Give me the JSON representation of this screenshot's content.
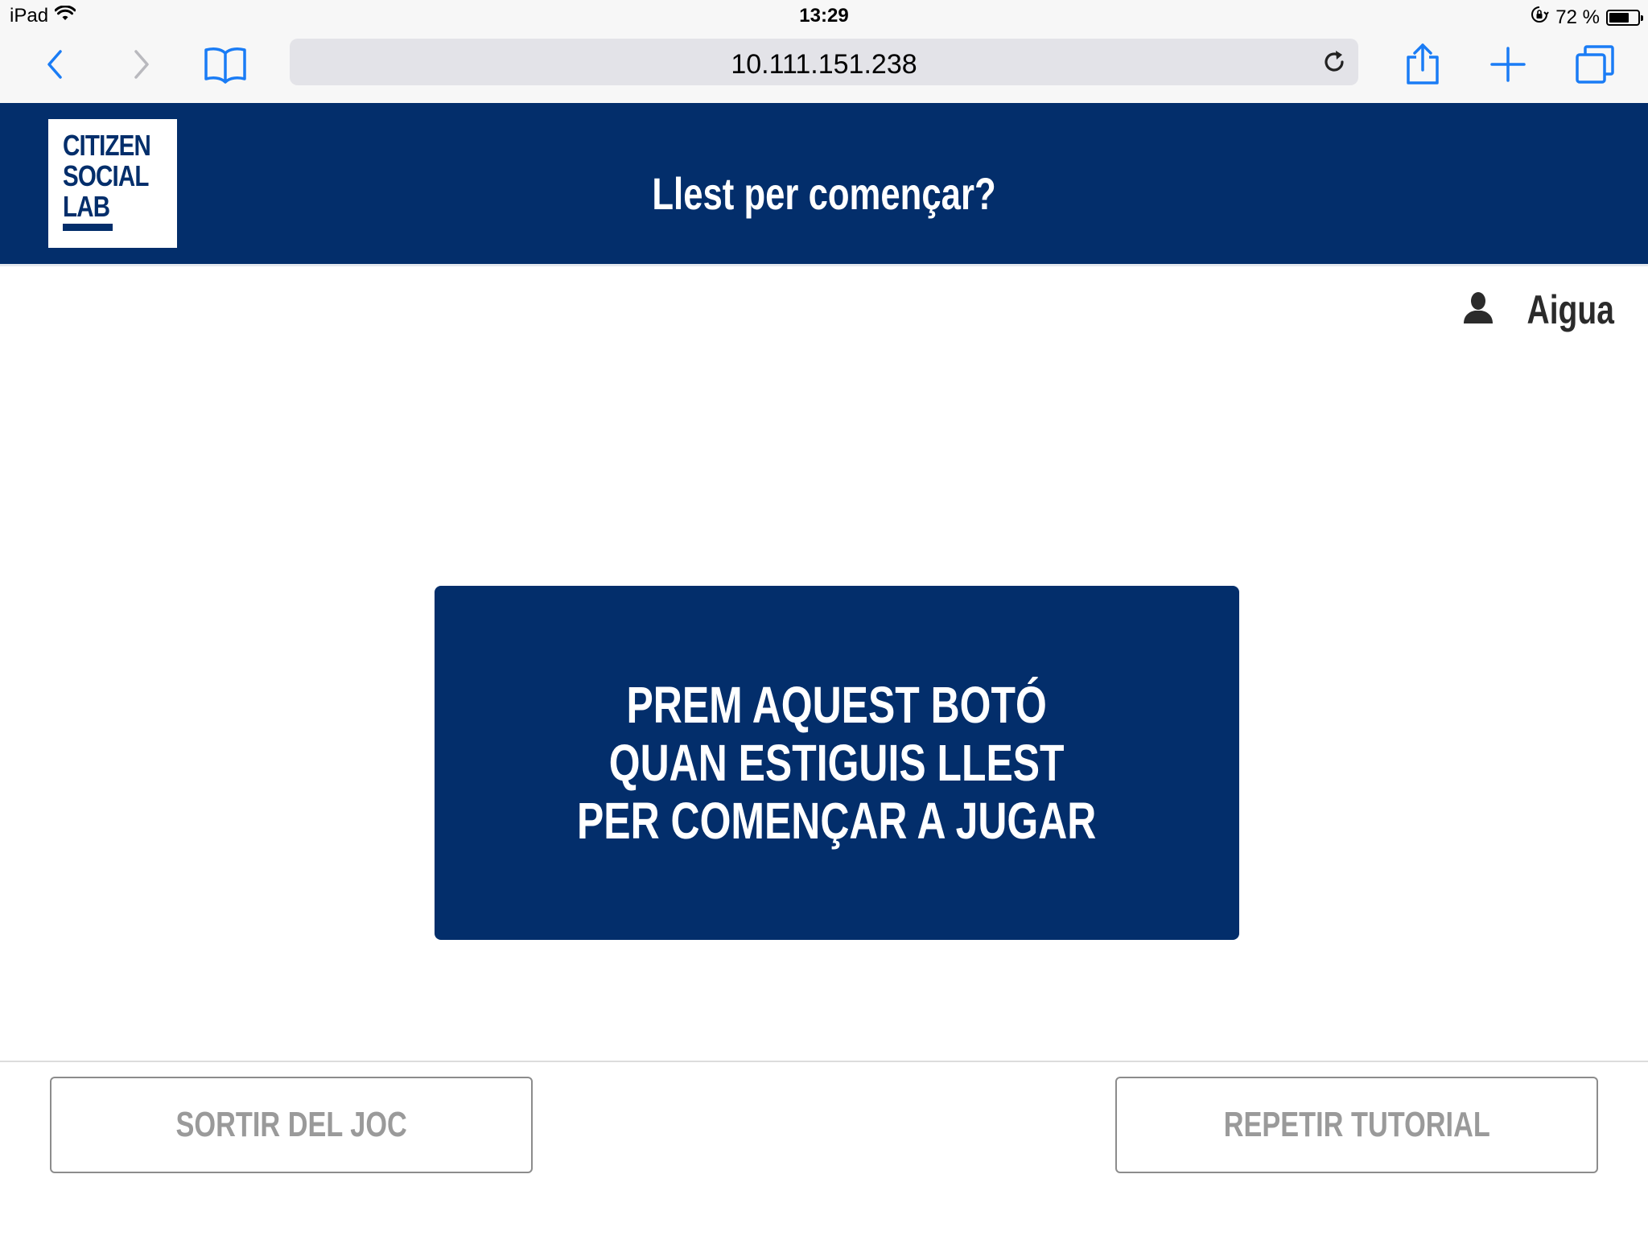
{
  "status_bar": {
    "device": "iPad",
    "time": "13:29",
    "battery_text": "72 %",
    "battery_level": 0.72
  },
  "browser": {
    "url": "10.111.151.238"
  },
  "header": {
    "logo_lines": [
      "CITIZEN",
      "SOCIAL",
      "LAB"
    ],
    "title": "Llest per començar?"
  },
  "user": {
    "name": "Aigua"
  },
  "main": {
    "start_button_lines": [
      "PREM AQUEST BOTÓ",
      "QUAN ESTIGUIS LLEST",
      "PER COMENÇAR A JUGAR"
    ]
  },
  "footer": {
    "exit_label": "SORTIR DEL JOC",
    "tutorial_label": "REPETIR TUTORIAL"
  },
  "colors": {
    "brand_navy": "#032e6b",
    "ios_blue": "#1a7cf5",
    "footer_text_gray": "#9a9a9a"
  }
}
